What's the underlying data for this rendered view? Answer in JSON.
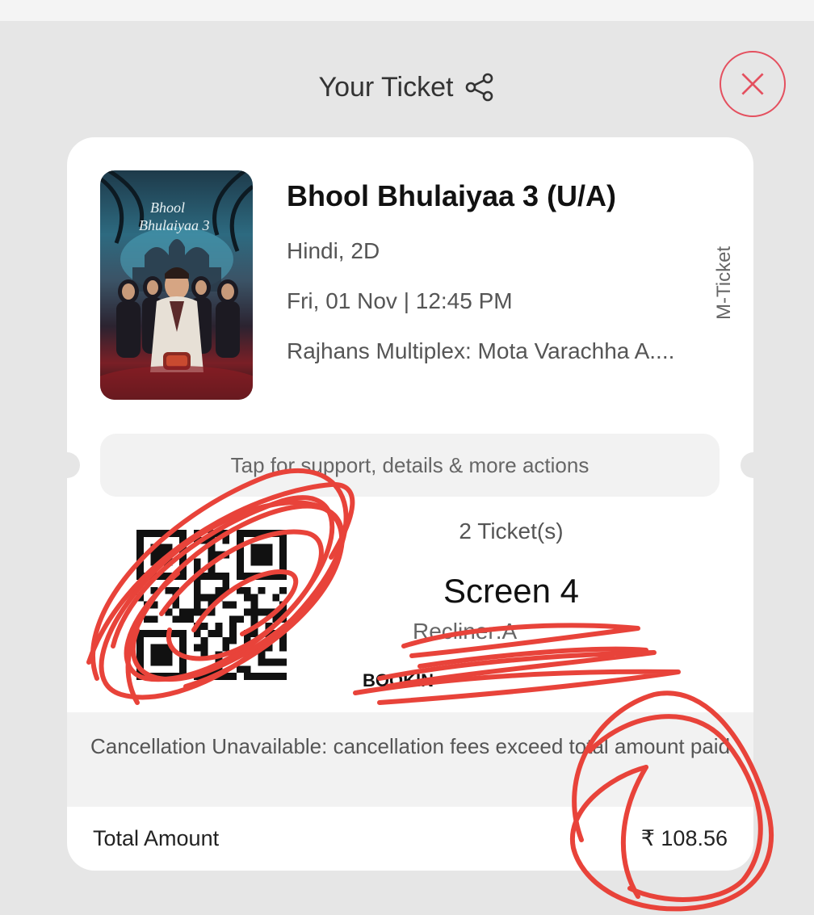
{
  "header": {
    "title": "Your Ticket",
    "share_icon": "share-icon",
    "close_icon": "close-icon",
    "accent_color": "#e4505f"
  },
  "movie": {
    "title": "Bhool Bhulaiyaa 3 (U/A)",
    "language_format": "Hindi, 2D",
    "datetime": "Fri, 01 Nov | 12:45 PM",
    "venue": "Rajhans Multiplex: Mota Varachha A....",
    "ticket_type": "M-Ticket",
    "poster_title_line1": "Bhool",
    "poster_title_line2": "Bhulaiyaa 3"
  },
  "support": {
    "label": "Tap for support, details & more actions"
  },
  "booking": {
    "tickets_count": "2 Ticket(s)",
    "screen": "Screen 4",
    "seat_info": "Recliner:A",
    "booking_id_label": "BOOKIN"
  },
  "cancellation": {
    "note": "Cancellation Unavailable: cancellation fees exceed total amount paid"
  },
  "total": {
    "label": "Total Amount",
    "amount": "₹ 108.56"
  },
  "annotation_color": "#e8433a"
}
